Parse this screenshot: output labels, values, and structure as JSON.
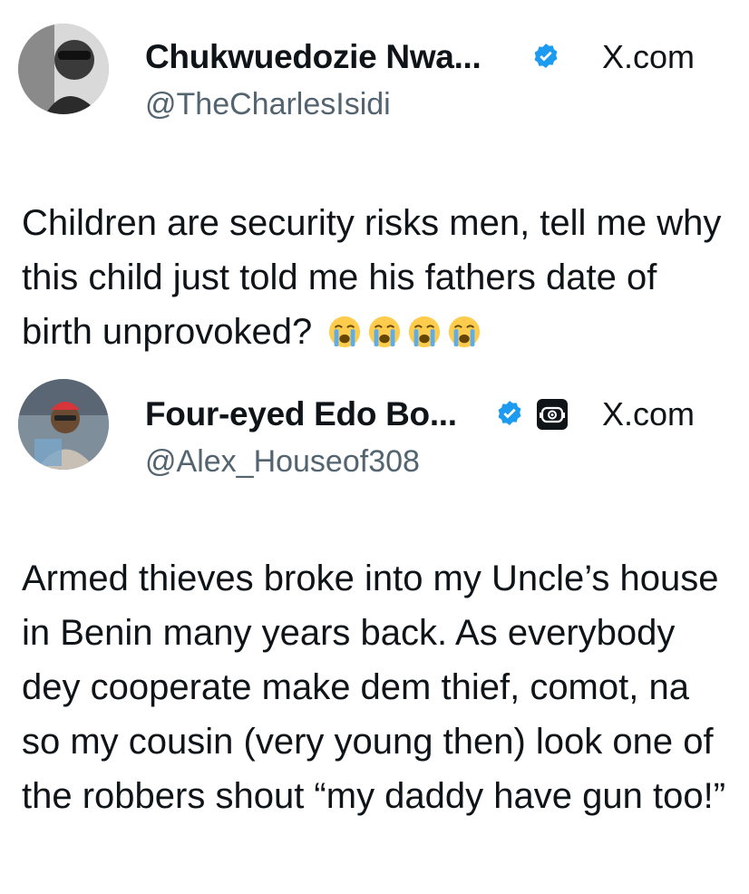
{
  "tweets": [
    {
      "display_name": "Chukwuedozie Nwa...",
      "handle": "@TheCharlesIsidi",
      "source": "X.com",
      "text": "Children are security risks men, tell me why this child just told me his fathers date of birth unprovoked?",
      "verified": true,
      "trailing_emojis": [
        "loudly-crying-face",
        "loudly-crying-face",
        "loudly-crying-face",
        "loudly-crying-face"
      ]
    },
    {
      "display_name": "Four-eyed Edo Bo...",
      "handle": "@Alex_Houseof308",
      "source": "X.com",
      "text": "Armed thieves broke into my Uncle’s house in Benin many years back. As everybody dey cooperate make dem thief, comot, na so my cousin (very young then) look one of the robbers shout “my daddy have gun too!”",
      "verified": true,
      "affiliate_badge": "robot-icon"
    }
  ],
  "colors": {
    "text": "#0f1419",
    "handle": "#536471",
    "verified": "#1d9bf0",
    "emoji_face": "#ffcc4d"
  }
}
